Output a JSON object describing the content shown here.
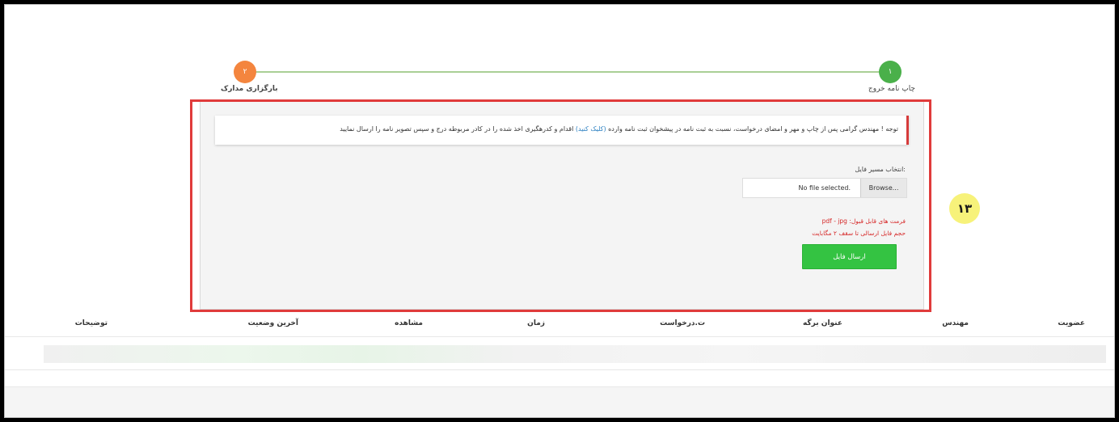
{
  "stepper": {
    "step1_number": "۱",
    "step1_label": "چاپ نامه خروج",
    "step2_number": "۲",
    "step2_label": "بارگزاری مدارک"
  },
  "notice": {
    "text_before": "توجه ! مهندس گرامی پس از چاپ و مهر و امضای درخواست، نسبت به ثبت نامه در پیشخوان ثبت نامه وارده",
    "link": "(کلیک کنید)",
    "text_after": "اقدام و کدرهگیری اخذ شده را در کادر مربوطه درج و سپس تصویر نامه را ارسال نمایید"
  },
  "upload": {
    "label": "انتخاب مسیر فایل:",
    "browse": "Browse...",
    "file_status": "No file selected.",
    "formats_line": "فرمت های قابل قبول: pdf - jpg",
    "size_line": "حجم فایل ارسالی تا سقف ۲ مگابایت",
    "submit": "ارسال فایل"
  },
  "badge": "۱۳",
  "table": {
    "headers": [
      "عضویت",
      "مهندس",
      "عنوان برگه",
      "ت.درخواست",
      "زمان",
      "مشاهده",
      "آخرین وضعیت",
      "توضیحات"
    ]
  },
  "colors": {
    "step_done": "#4ab04a",
    "step_current": "#f4853e",
    "highlight": "#e03b3b",
    "submit": "#34c342",
    "badge": "#f7f27a"
  }
}
